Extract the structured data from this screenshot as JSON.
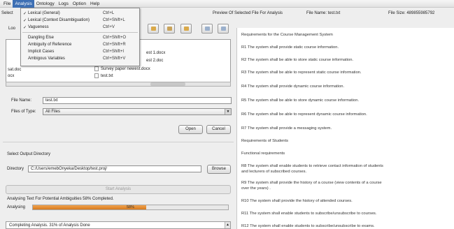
{
  "menubar": {
    "items": [
      "File",
      "Analysis",
      "Ontology",
      "Logs",
      "Option",
      "Help"
    ],
    "active": "Analysis"
  },
  "analysis_menu": [
    {
      "check": "✓",
      "label": "Lexical (General)",
      "shortcut": "Ctrl+L"
    },
    {
      "check": "✓",
      "label": "Lexical (Context Disambiguation)",
      "shortcut": "Ctrl+Shift+L"
    },
    {
      "check": "✓",
      "label": "Vagueness",
      "shortcut": "Ctrl+V"
    },
    {
      "check": "",
      "label": "Dangling Else",
      "shortcut": "Ctrl+Shift+O"
    },
    {
      "check": "",
      "label": "Ambiguity of Reference",
      "shortcut": "Ctrl+Shift+R"
    },
    {
      "check": "",
      "label": "Implicit Cases",
      "shortcut": "Ctrl+Shift+I"
    },
    {
      "check": "",
      "label": "Ambigous Variables",
      "shortcut": "Ctrl+Shift+V"
    }
  ],
  "header": {
    "left_partial": "Select",
    "preview_label": "Preview Of Selected File For Analysis",
    "file_name": "File Name: test.txt",
    "file_size": "File Size: 489855985792"
  },
  "chooser": {
    "look_in_partial": "Loo",
    "files": [
      {
        "name": "est 1.docx"
      },
      {
        "name": "est 2.doc"
      },
      {
        "name": "Survey paper newest.docx"
      },
      {
        "name": "test.txt"
      }
    ],
    "left_files": [
      "sat.doc",
      "ocx"
    ],
    "file_name_label": "File Name:",
    "file_name_value": "test.txt",
    "files_of_type_label": "Files of Type:",
    "files_of_type_value": "All Files",
    "open_label": "Open",
    "cancel_label": "Cancel"
  },
  "output": {
    "title": "Select Output Directory",
    "directory_label": "Directory",
    "directory_value": "C:/Users/emebOnyeka/Desktop/test.proj/",
    "browse_label": "Browse",
    "start_label": "Start Analysis"
  },
  "progress": {
    "status_text": "Analysing Text For Potential Ambiguities 58% Completed.",
    "label": "Analysing",
    "value": 58,
    "percent_text": "58%"
  },
  "status_box": {
    "text": "Completing Analysis. 31% of Analysis Done"
  },
  "preview_lines": [
    "Requirements for the Course Management System",
    "R1  The system shall provide static course information.",
    "R2  The system shall be able to store static course information.",
    "R3  The system shall be able to represent static course information.",
    "R4  The system shall provide dynamic course information.",
    "R5  The system shall be able to store dynamic course information.",
    "R6  The system shall be able to represent dynamic course information.",
    "R7  The system shall provide a messaging system.",
    "Requirements of Students",
    "Functional requirements",
    "R8  The system shall enable students to retrieve contact information of students",
    "and lecturers of subscribed courses.",
    "R9  The system shall provide the history of a course (view contents of a course",
    "over the years) .",
    "R10  The system shall provide the history of attended courses.",
    "R11  The system shall enable students to subscribe/unsubscribe to courses.",
    "R12  The system shall enable students to subscribe/unsubscribe to exams."
  ],
  "colors": {
    "menu_highlight": "#3d6fb4",
    "progress_fill": "#e08a2e"
  }
}
